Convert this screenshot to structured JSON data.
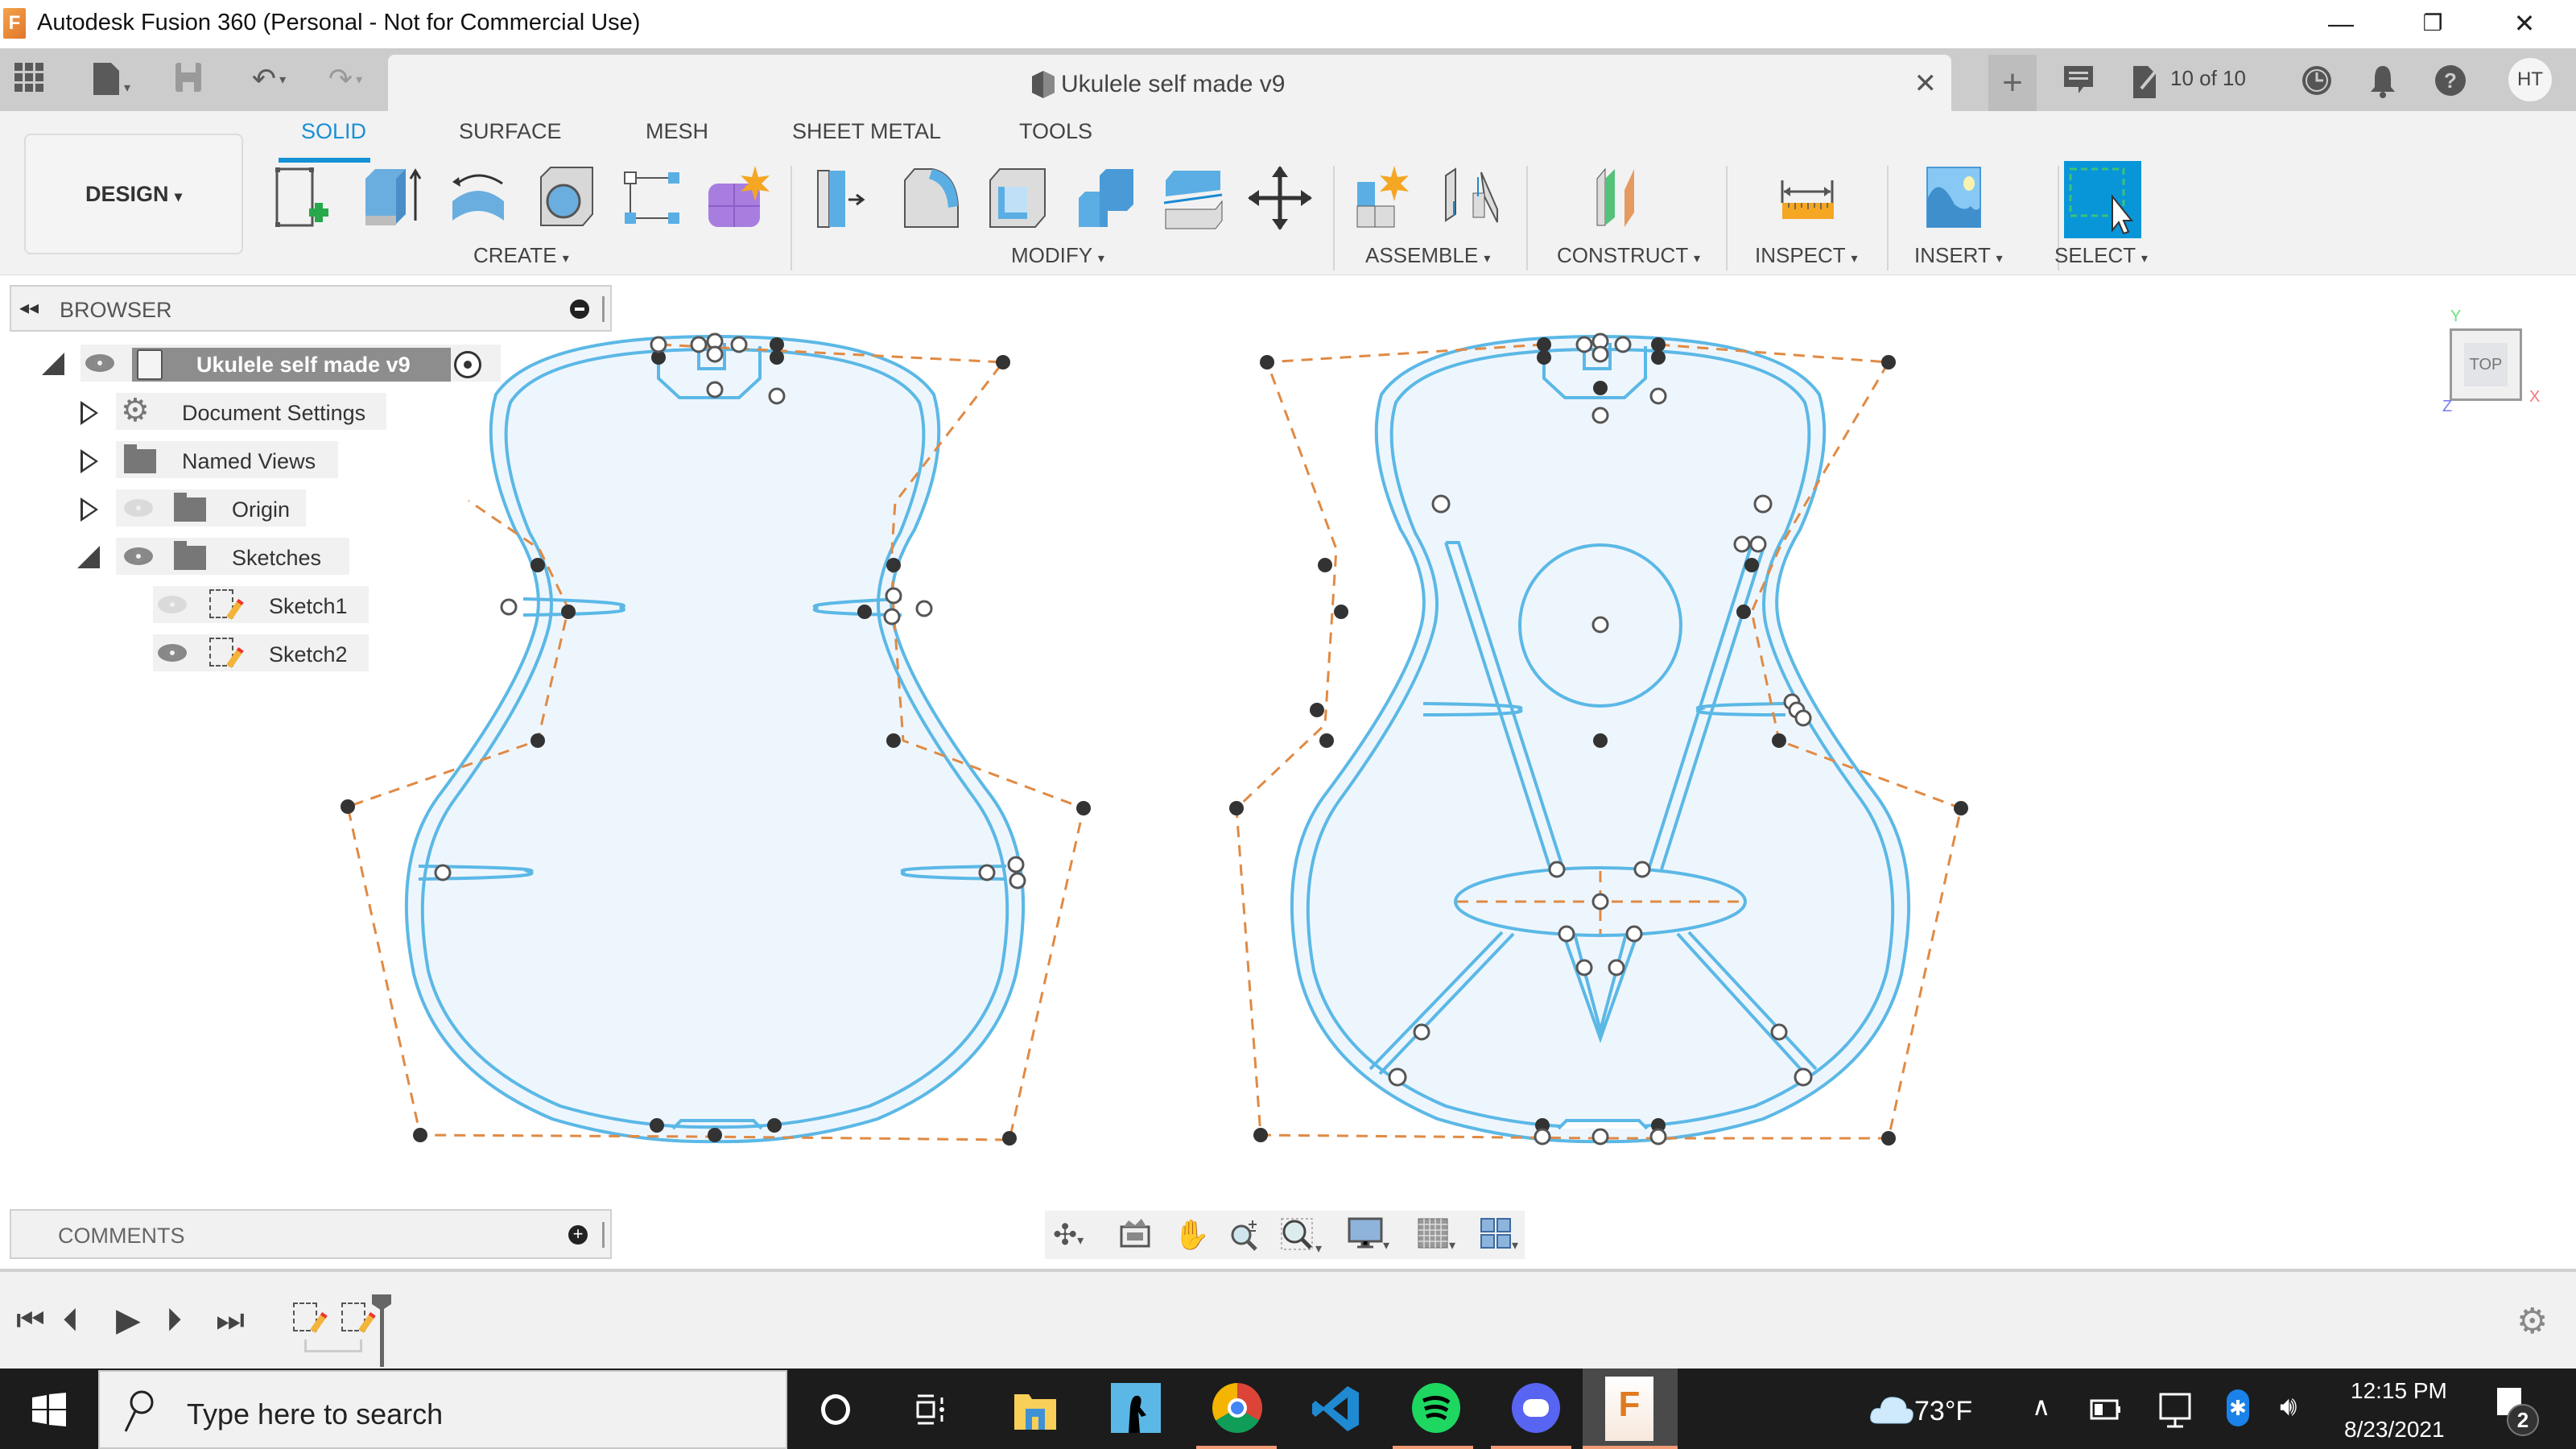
{
  "window": {
    "title": "Autodesk Fusion 360 (Personal - Not for Commercial Use)",
    "logo_letter": "F",
    "controls": {
      "minimize": "—",
      "restore": "❐",
      "close": "✕"
    }
  },
  "appbar": {
    "document_title": "Ukulele self made v9",
    "close_tab": "✕",
    "new_tab": "+",
    "jobs_status": "10 of 10",
    "user_initials": "HT",
    "icons": [
      "data-panel-grid-icon",
      "file-icon",
      "save-icon",
      "undo-icon",
      "redo-icon",
      "comment-icon",
      "job-status-icon",
      "clock-icon",
      "bell-icon",
      "help-icon"
    ]
  },
  "ribbon": {
    "workspace": "DESIGN",
    "tabs": [
      "SOLID",
      "SURFACE",
      "MESH",
      "SHEET METAL",
      "TOOLS"
    ],
    "active_tab": "SOLID",
    "groups": [
      "CREATE",
      "MODIFY",
      "ASSEMBLE",
      "CONSTRUCT",
      "INSPECT",
      "INSERT",
      "SELECT"
    ],
    "caret": "▾",
    "colors": {
      "accent": "#1592d6",
      "tool_blue": "#5aaee4",
      "select_bg": "#0896d9",
      "construct_green": "#55c27a",
      "construct_orange": "#e59a60",
      "inspect_orange": "#f5a623"
    }
  },
  "browser": {
    "title": "BROWSER",
    "root": "Ukulele self made v9",
    "items": [
      {
        "label": "Document Settings",
        "icon": "gear-icon",
        "expanded": false
      },
      {
        "label": "Named Views",
        "icon": "folder-icon",
        "expanded": false
      },
      {
        "label": "Origin",
        "icon": "folder-icon",
        "expanded": false,
        "visible": false
      },
      {
        "label": "Sketches",
        "icon": "folder-icon",
        "expanded": true,
        "visible": true
      }
    ],
    "sketches": [
      {
        "label": "Sketch1",
        "visible": false
      },
      {
        "label": "Sketch2",
        "visible": true
      }
    ]
  },
  "viewcube": {
    "face": "TOP",
    "axes": {
      "x": "X",
      "y": "Y",
      "z": "Z"
    }
  },
  "comments": {
    "title": "COMMENTS"
  },
  "navbar": {
    "icons": [
      "orbit-icon",
      "look-at-icon",
      "pan-icon",
      "zoom-icon",
      "fit-icon",
      "display-settings-icon",
      "grid-icon",
      "viewports-icon"
    ]
  },
  "timeline": {
    "controls": [
      "go-to-start",
      "step-back",
      "play",
      "step-forward",
      "go-to-end"
    ],
    "features": [
      "Sketch1",
      "Sketch2"
    ]
  },
  "sketch_colors": {
    "curve": "#5bb8e6",
    "fill": "#eef6fd",
    "construction": "#e08a44",
    "point_fixed": "#333333"
  },
  "taskbar": {
    "search_placeholder": "Type here to search",
    "apps": [
      "cortana",
      "task-view",
      "file-explorer",
      "kindle",
      "chrome",
      "vscode",
      "spotify",
      "discord",
      "fusion-360"
    ],
    "weather": "73°F",
    "time": "12:15 PM",
    "date": "8/23/2021",
    "notifications": "2"
  }
}
